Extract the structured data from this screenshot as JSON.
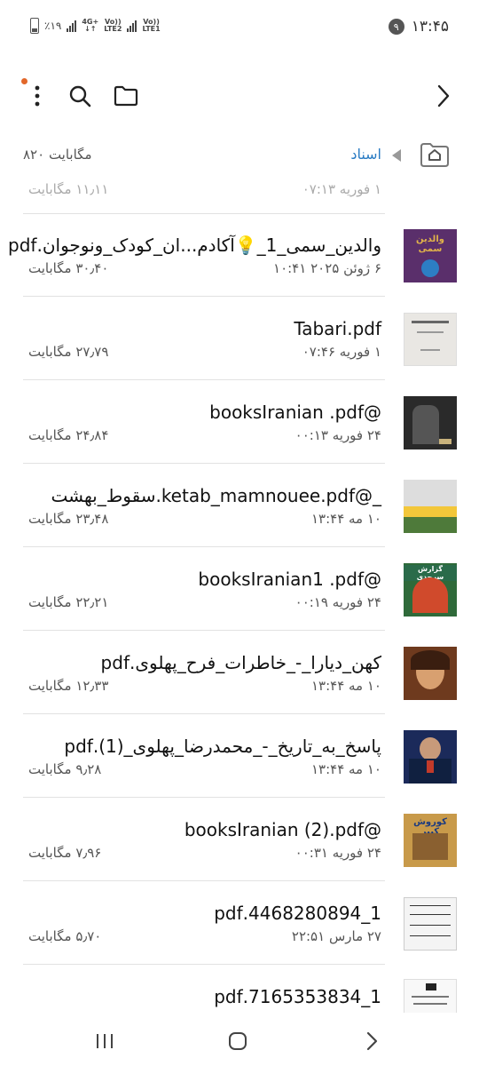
{
  "status_bar": {
    "time": "۱۳:۴۵",
    "notification_count": "۹",
    "battery": "٪۱۹",
    "network_1": "4G+",
    "network_2a": "Vo))",
    "network_2b": "LTE2",
    "network_3a": "Vo))",
    "network_3b": "LTE1"
  },
  "path_bar": {
    "folder_name": "اسناد",
    "storage_size": "۸۲۰ مگابایت"
  },
  "partial_row": {
    "date": "۱ فوریه ۰۷:۱۳",
    "size": "۱۱٫۱۱ مگابایت"
  },
  "files": [
    {
      "name": "والدین_سمی_1_💡آکادم...ان_کودک_ونوجوان.pdf",
      "date": "۶ ژوئن ۲۰۲۵ ۱۰:۴۱",
      "size": "۳۰٫۴۰ مگابایت",
      "thumb_color": "#5a2f6b",
      "thumb_accent": "#e0b24a"
    },
    {
      "name": "Tabari.pdf",
      "date": "۱ فوریه ۰۷:۴۶",
      "size": "۲۷٫۷۹ مگابایت",
      "thumb_color": "#e9e7e3",
      "thumb_accent": "#555555"
    },
    {
      "name": "@booksIranian .pdf",
      "date": "۲۴ فوریه ۰۰:۱۳",
      "size": "۲۴٫۸۴ مگابایت",
      "thumb_color": "#2a2a2a",
      "thumb_accent": "#c8b27c"
    },
    {
      "name": "_@ketab_mamnouee.pdf.سقوط_بهشت",
      "date": "۱۰ مه ۱۳:۴۴",
      "size": "۲۳٫۴۸ مگابایت",
      "thumb_color": "#4e7a3a",
      "thumb_accent": "#f3c73a"
    },
    {
      "name": "@booksIranian1 .pdf",
      "date": "۲۴ فوریه ۰۰:۱۹",
      "size": "۲۲٫۲۱ مگابایت",
      "thumb_color": "#2f6a3a",
      "thumb_accent": "#d04a2c"
    },
    {
      "name": "کهن_دیارا_-_خاطرات_فرح_پهلوی.pdf",
      "date": "۱۰ مه ۱۳:۴۴",
      "size": "۱۲٫۳۳ مگابایت",
      "thumb_color": "#6e3a1e",
      "thumb_accent": "#d8a070"
    },
    {
      "name": "پاسخ_به_تاریخ_-_محمدرضا_پهلوی_(1).pdf",
      "date": "۱۰ مه ۱۳:۴۴",
      "size": "۹٫۲۸ مگابایت",
      "thumb_color": "#1b2a5a",
      "thumb_accent": "#c23a2a"
    },
    {
      "name": "@booksIranian  (2).pdf",
      "date": "۲۴ فوریه ۰۰:۳۱",
      "size": "۷٫۹۶ مگابایت",
      "thumb_color": "#c89a4a",
      "thumb_accent": "#3a5aa0"
    },
    {
      "name": "1_4468280894.pdf",
      "date": "۲۷ مارس ۲۲:۵۱",
      "size": "۵٫۷۰ مگابایت",
      "thumb_color": "#f4f4f4",
      "thumb_accent": "#333333"
    },
    {
      "name": "1_7165353834.pdf",
      "date": "",
      "size": "",
      "thumb_color": "#f8f8f8",
      "thumb_accent": "#222222"
    }
  ],
  "thumb_labels": {
    "file_1": "والدین سمی",
    "file_5": "گزارش سرحدی",
    "file_8": "کوروش کبیر"
  },
  "icons": {
    "more": "more-vertical-icon",
    "search": "search-icon",
    "folder": "folder-icon",
    "forward": "chevron-right-icon",
    "home": "home-icon",
    "recents": "recent-apps-icon",
    "home_nav": "home-nav-icon",
    "back": "back-nav-icon"
  },
  "colors": {
    "accent": "#2a7cc4",
    "notification_dot": "#e2672a"
  }
}
